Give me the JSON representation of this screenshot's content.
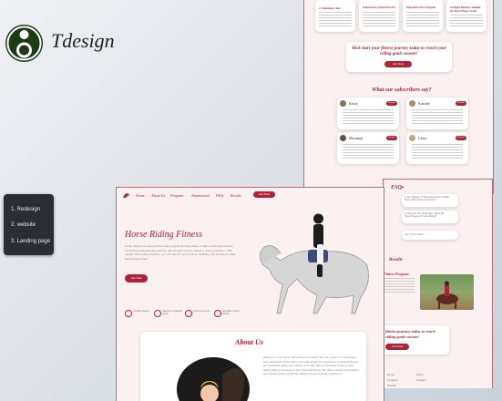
{
  "brand": {
    "name": "Tdesign"
  },
  "menu": {
    "items": [
      "1. Redesign",
      "2. website",
      "3. Landing page"
    ]
  },
  "main": {
    "nav": [
      "Home",
      "About Us",
      "Program",
      "Testimonials",
      "FAQs",
      "Results"
    ],
    "nav_cta": "Join Now",
    "hero_title": "Horse Riding Fitness",
    "hero_text": "Horse riding is a unique and fun way to get fit and stay active. It offers a full-body workout, combining cardiovascular exercise with strength training, balance, and coordination. With regular horse riding sessions, you can improve your posture, flexibility, and endurance while also having a blast.",
    "hero_cta": "Join Now",
    "badges": [
      "Certified trainers",
      "Tailored to individual needs",
      "Improved posture",
      "Enjoyable outdoor activity"
    ],
    "about_title": "About Us",
    "about_text": "Welcome to our horse riding fitness company! We are a team of experienced and passionate horse riders who understand the importance of physical fitness for horseback riding. Our mission is to help riders of all levels improve their riding skills by focusing on their physical fitness. We offer a variety of programs and training sessions that are tailored to your specific needs and"
  },
  "top": {
    "program_titles": [
      "4. Endurance class",
      "Enhanced by Equestrian Pro",
      "Equestrian Pose Program",
      "Certified Business Suitable for Most Fitness Levels"
    ],
    "cta_heading": "Kick start your fitness journey today to reach your riding goals sooner!",
    "cta_button": "Join Now",
    "subscribers_title": "What our subscribers say?",
    "testimonials": [
      {
        "name": "Kristy",
        "tag": "Member"
      },
      {
        "name": "Kassidy",
        "tag": "Member"
      },
      {
        "name": "Marianna",
        "tag": "Member"
      },
      {
        "name": "Laura",
        "tag": "Member"
      }
    ]
  },
  "right": {
    "faqs_title": "FAQs",
    "faqs": [
      "1. Do I Require To Have Experience To Start Horse Riding Fitness Training?",
      "2. What Are The Of Program Offers We Have Program of Horse Riding?",
      "Can I Join A Class?"
    ],
    "results_title": "Results",
    "results_sub": "Fitness Program",
    "cta_heading": "fitness journey today to reach riding goals sooner!",
    "cta_button": "Join Now",
    "footer_cols": [
      [
        "Home",
        "Program",
        "Results"
      ],
      [
        "FAQs",
        "Careers"
      ]
    ]
  },
  "colors": {
    "accent": "#b02236",
    "frame": "#c06a74",
    "logo": "#1e3a16"
  }
}
